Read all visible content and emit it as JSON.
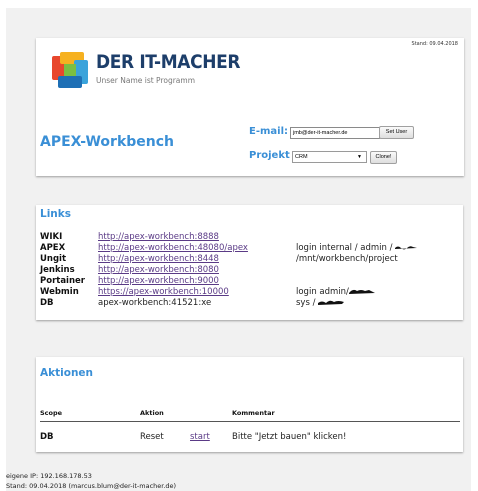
{
  "header": {
    "stand": "Stand: 09.04.2018",
    "brand_name": "DER IT-MACHER",
    "brand_slogan": "Unser Name ist Programm",
    "app_title": "APEX-Workbench",
    "email_label": "E-mail:",
    "email_value": "jmb@der-it-macher.de",
    "set_user_label": "Set User",
    "projekt_label": "Projekt",
    "projekt_selected": "CRM",
    "clone_label": "Clone!",
    "logo_colors": [
      "#e8472d",
      "#f6b120",
      "#3aa3db",
      "#1e6fb5",
      "#7bbf43"
    ]
  },
  "links": {
    "title": "Links",
    "rows": [
      {
        "name": "WIKI",
        "url": "http://apex-workbench:8888",
        "note": ""
      },
      {
        "name": "APEX",
        "url": "http://apex-workbench:48080/apex",
        "note": "login internal / admin / "
      },
      {
        "name": "Ungit",
        "url": "http://apex-workbench:8448",
        "note": "/mnt/workbench/project"
      },
      {
        "name": "Jenkins",
        "url": "http://apex-workbench:8080",
        "note": ""
      },
      {
        "name": "Portainer",
        "url": "http://apex-workbench:9000",
        "note": ""
      },
      {
        "name": "Webmin",
        "url": "https://apex-workbench:10000",
        "note": "login admin/"
      },
      {
        "name": "DB",
        "url": "apex-workbench:41521:xe",
        "note": "sys / "
      }
    ]
  },
  "actions": {
    "title": "Aktionen",
    "columns": [
      "Scope",
      "Aktion",
      "Kommentar"
    ],
    "rows": [
      {
        "scope": "DB",
        "aktion": "Reset",
        "link": "start",
        "kommentar": "Bitte \"Jetzt bauen\" klicken!"
      }
    ]
  },
  "footer": {
    "ip": "eigene IP: 192.168.178.53",
    "stand": "Stand: 09.04.2018 (marcus.blum@der-it-macher.de)"
  },
  "colors": {
    "accent": "#3a8fd6",
    "brand": "#1d3e6a",
    "link": "#5a3a86"
  }
}
